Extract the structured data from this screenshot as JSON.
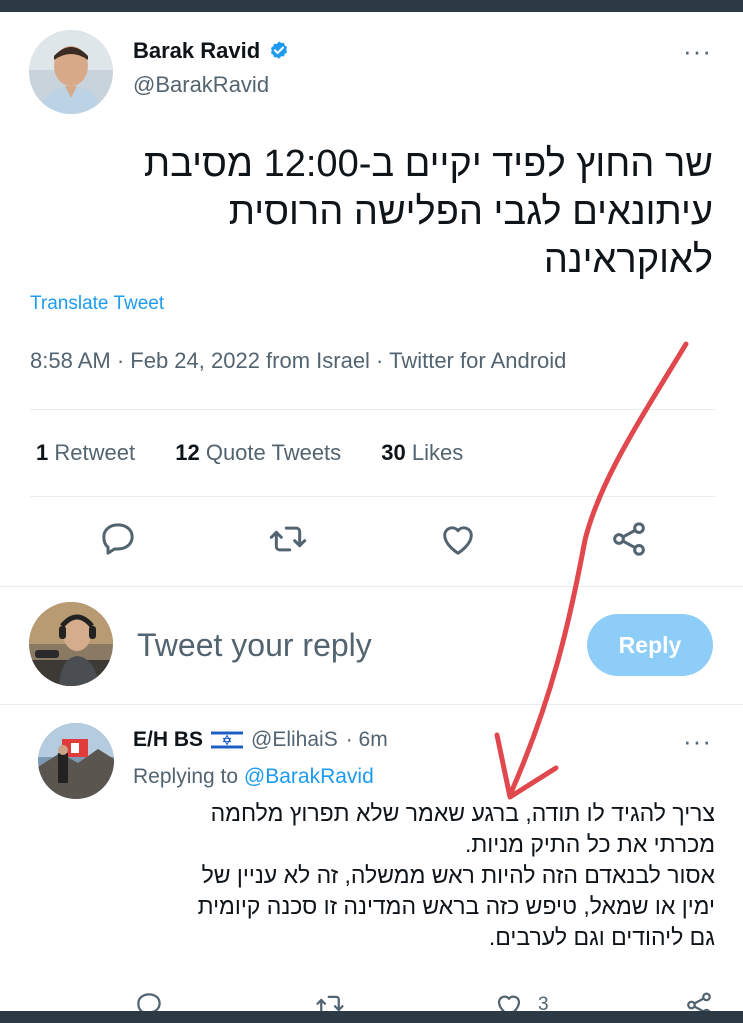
{
  "tweet": {
    "author_name": "Barak Ravid",
    "author_handle": "@BarakRavid",
    "text_lines": [
      "שר החוץ לפיד יקיים ב-12:00 מסיבת",
      "עיתונאים לגבי הפלישה הרוסית",
      "לאוקראינה"
    ],
    "translate_label": "Translate Tweet",
    "meta": "8:58 AM · Feb 24, 2022 from Israel · Twitter for Android",
    "stats": {
      "retweets_count": "1",
      "retweets_label": "Retweet",
      "quotes_count": "12",
      "quotes_label": "Quote Tweets",
      "likes_count": "30",
      "likes_label": "Likes"
    },
    "more_label": "···"
  },
  "composer": {
    "placeholder": "Tweet your reply",
    "reply_button": "Reply"
  },
  "reply": {
    "author_name": "E/H BS",
    "author_handle": "@ElihaiS",
    "time": "· 6m",
    "replying_prefix": "Replying to",
    "replying_handle": "@BarakRavid",
    "text_lines": [
      "צריך להגיד לו תודה, ברגע שאמר שלא תפרוץ מלחמה",
      "מכרתי את כל התיק מניות.",
      "אסור לבנאדם הזה להיות ראש ממשלה, זה לא עניין של",
      "ימין או שמאל, טיפש כזה בראש המדינה זו סכנה קיומית",
      "גם ליהודים וגם לערבים."
    ],
    "like_count": "3",
    "more_label": "···"
  },
  "colors": {
    "accent": "#1d9bf0",
    "reply_button_bg": "#8ecdf8",
    "secondary_text": "#536471",
    "annotation_arrow": "#e0484d",
    "frame": "#2b3a44"
  },
  "icons": [
    "verified-badge-icon",
    "reply-icon",
    "retweet-icon",
    "like-icon",
    "share-icon",
    "israel-flag-icon",
    "more-icon"
  ]
}
